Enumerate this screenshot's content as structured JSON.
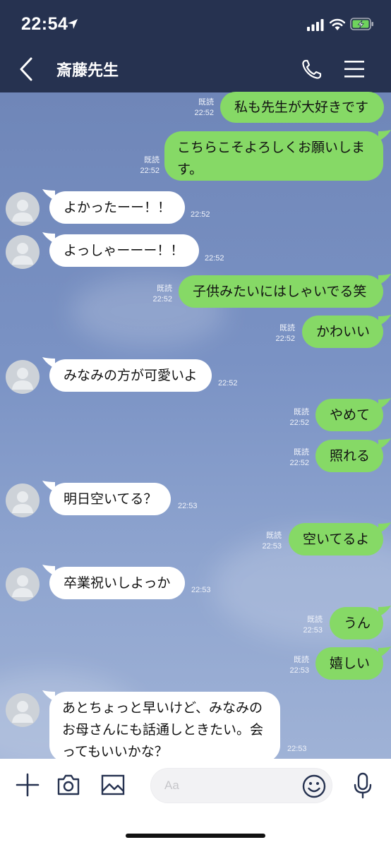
{
  "status_bar": {
    "time": "22:54"
  },
  "header": {
    "title": "斎藤先生"
  },
  "messages": [
    {
      "side": "out",
      "text": "私も先生が大好きです",
      "read": "既読",
      "time": "22:52"
    },
    {
      "side": "out",
      "text": "こちらこそよろしくお願いします。",
      "read": "既読",
      "time": "22:52"
    },
    {
      "side": "in",
      "text": "よかったーー！！",
      "time": "22:52"
    },
    {
      "side": "in",
      "text": "よっしゃーーー！！",
      "time": "22:52"
    },
    {
      "side": "out",
      "text": "子供みたいにはしゃいでる笑",
      "read": "既読",
      "time": "22:52"
    },
    {
      "side": "out",
      "text": "かわいい",
      "read": "既読",
      "time": "22:52"
    },
    {
      "side": "in",
      "text": "みなみの方が可愛いよ",
      "time": "22:52"
    },
    {
      "side": "out",
      "text": "やめて",
      "read": "既読",
      "time": "22:52"
    },
    {
      "side": "out",
      "text": "照れる",
      "read": "既読",
      "time": "22:52"
    },
    {
      "side": "in",
      "text": "明日空いてる？",
      "time": "22:53"
    },
    {
      "side": "out",
      "text": "空いてるよ",
      "read": "既読",
      "time": "22:53"
    },
    {
      "side": "in",
      "text": "卒業祝いしよっか",
      "time": "22:53"
    },
    {
      "side": "out",
      "text": "うん",
      "read": "既読",
      "time": "22:53"
    },
    {
      "side": "out",
      "text": "嬉しい",
      "read": "既読",
      "time": "22:53"
    },
    {
      "side": "in",
      "text": "あとちょっと早いけど、みなみのお母さんにも話通しときたい。会ってもいいかな？",
      "time": "22:53"
    }
  ],
  "composer": {
    "placeholder": "Aa"
  },
  "colors": {
    "header_bg": "#263250",
    "outgoing_bubble": "#86d966",
    "incoming_bubble": "#ffffff"
  },
  "icons": [
    "location-arrow-icon",
    "signal-icon",
    "wifi-icon",
    "battery-charging-icon",
    "back-chevron-icon",
    "phone-icon",
    "menu-icon",
    "plus-icon",
    "camera-icon",
    "image-icon",
    "emoji-icon",
    "microphone-icon"
  ]
}
